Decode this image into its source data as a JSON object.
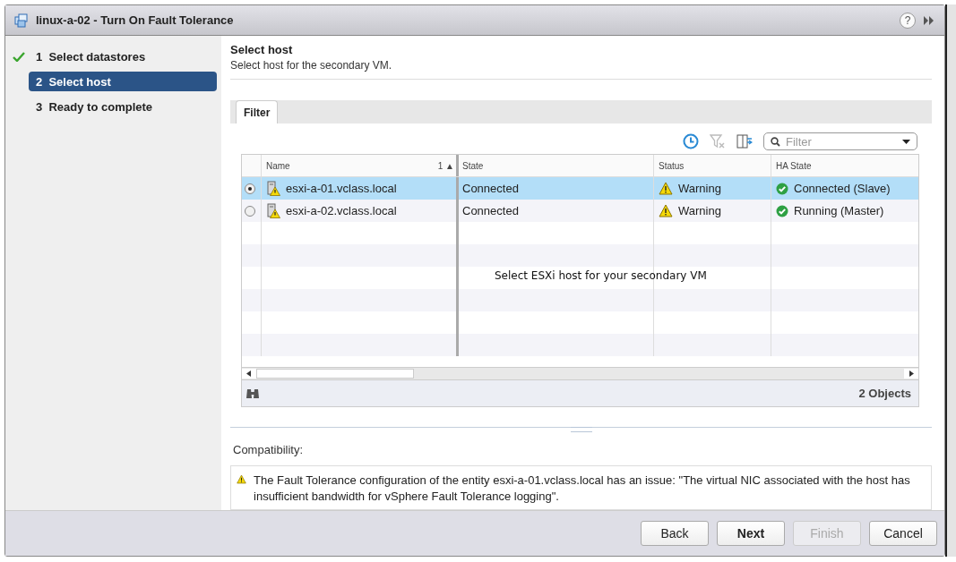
{
  "window": {
    "title": "linux-a-02 - Turn On Fault Tolerance",
    "help_glyph": "?"
  },
  "steps": [
    {
      "number": "1",
      "label": "Select datastores",
      "completed": true,
      "selected": false
    },
    {
      "number": "2",
      "label": "Select host",
      "completed": false,
      "selected": true
    },
    {
      "number": "3",
      "label": "Ready to complete",
      "completed": false,
      "selected": false
    }
  ],
  "page": {
    "title": "Select host",
    "subtitle": "Select host for the secondary VM."
  },
  "tabs": [
    {
      "label": "Filter",
      "selected": true
    }
  ],
  "filter": {
    "placeholder": "Filter"
  },
  "table": {
    "columns": [
      {
        "label": "Name",
        "sort": "1 ▲"
      },
      {
        "label": "State"
      },
      {
        "label": "Status"
      },
      {
        "label": "HA State"
      }
    ],
    "rows": [
      {
        "selected": true,
        "host_alert": true,
        "name": "esxi-a-01.vclass.local",
        "state": "Connected",
        "status": {
          "kind": "warning",
          "text": "Warning"
        },
        "ha_state": {
          "kind": "ok",
          "text": "Connected (Slave)"
        }
      },
      {
        "selected": false,
        "host_alert": true,
        "name": "esxi-a-02.vclass.local",
        "state": "Connected",
        "status": {
          "kind": "warning",
          "text": "Warning"
        },
        "ha_state": {
          "kind": "ok",
          "text": "Running (Master)"
        }
      }
    ],
    "object_count": "2 Objects"
  },
  "overlay_note": "Select ESXi host for your secondary VM",
  "compatibility": {
    "label": "Compatibility:",
    "kind": "warning",
    "message": "The Fault Tolerance configuration of the entity esxi-a-01.vclass.local has an issue: \"The virtual NIC associated with the host has insufficient bandwidth for vSphere Fault Tolerance logging\"."
  },
  "buttons": [
    {
      "label": "Back",
      "kind": "normal",
      "disabled": false
    },
    {
      "label": "Next",
      "kind": "primary",
      "disabled": false
    },
    {
      "label": "Finish",
      "kind": "normal",
      "disabled": true
    },
    {
      "label": "Cancel",
      "kind": "normal",
      "disabled": false
    }
  ]
}
